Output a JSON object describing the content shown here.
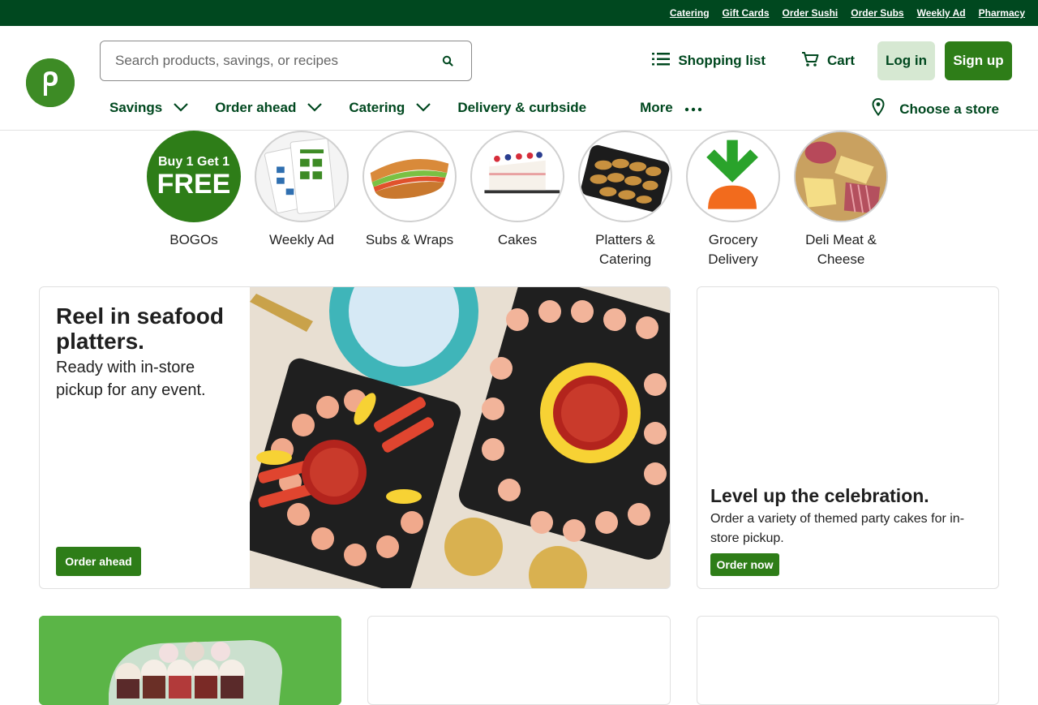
{
  "topbar": {
    "links": [
      "Catering",
      "Gift Cards",
      "Order Sushi",
      "Order Subs",
      "Weekly Ad",
      "Pharmacy"
    ]
  },
  "header": {
    "logo_letter": "p",
    "search": {
      "placeholder": "Search products, savings, or recipes"
    },
    "shopping_list": "Shopping list",
    "cart": "Cart",
    "login": "Log in",
    "signup": "Sign up"
  },
  "nav": {
    "items": [
      "Savings",
      "Order ahead",
      "Catering",
      "Delivery & curbside",
      "More"
    ],
    "store": "Choose a store"
  },
  "categories": [
    {
      "label": "BOGOs",
      "badge_line1": "Buy 1 Get 1",
      "badge_line2": "FREE"
    },
    {
      "label": "Weekly Ad"
    },
    {
      "label": "Subs & Wraps"
    },
    {
      "label": "Cakes"
    },
    {
      "label": "Platters & Catering"
    },
    {
      "label": "Grocery Delivery"
    },
    {
      "label": "Deli Meat & Cheese"
    }
  ],
  "hero": {
    "title": "Reel in seafood platters.",
    "subtitle": "Ready with in-store pickup for any event.",
    "button": "Order ahead"
  },
  "side_promo": {
    "title": "Level up the celebration.",
    "body": "Order a variety of themed party cakes for in-store pickup.",
    "button": "Order now"
  },
  "colors": {
    "brand_dark": "#00481f",
    "brand_green": "#2e7d18",
    "logo_green": "#3d8b25",
    "login_bg": "#d6e8d2"
  }
}
